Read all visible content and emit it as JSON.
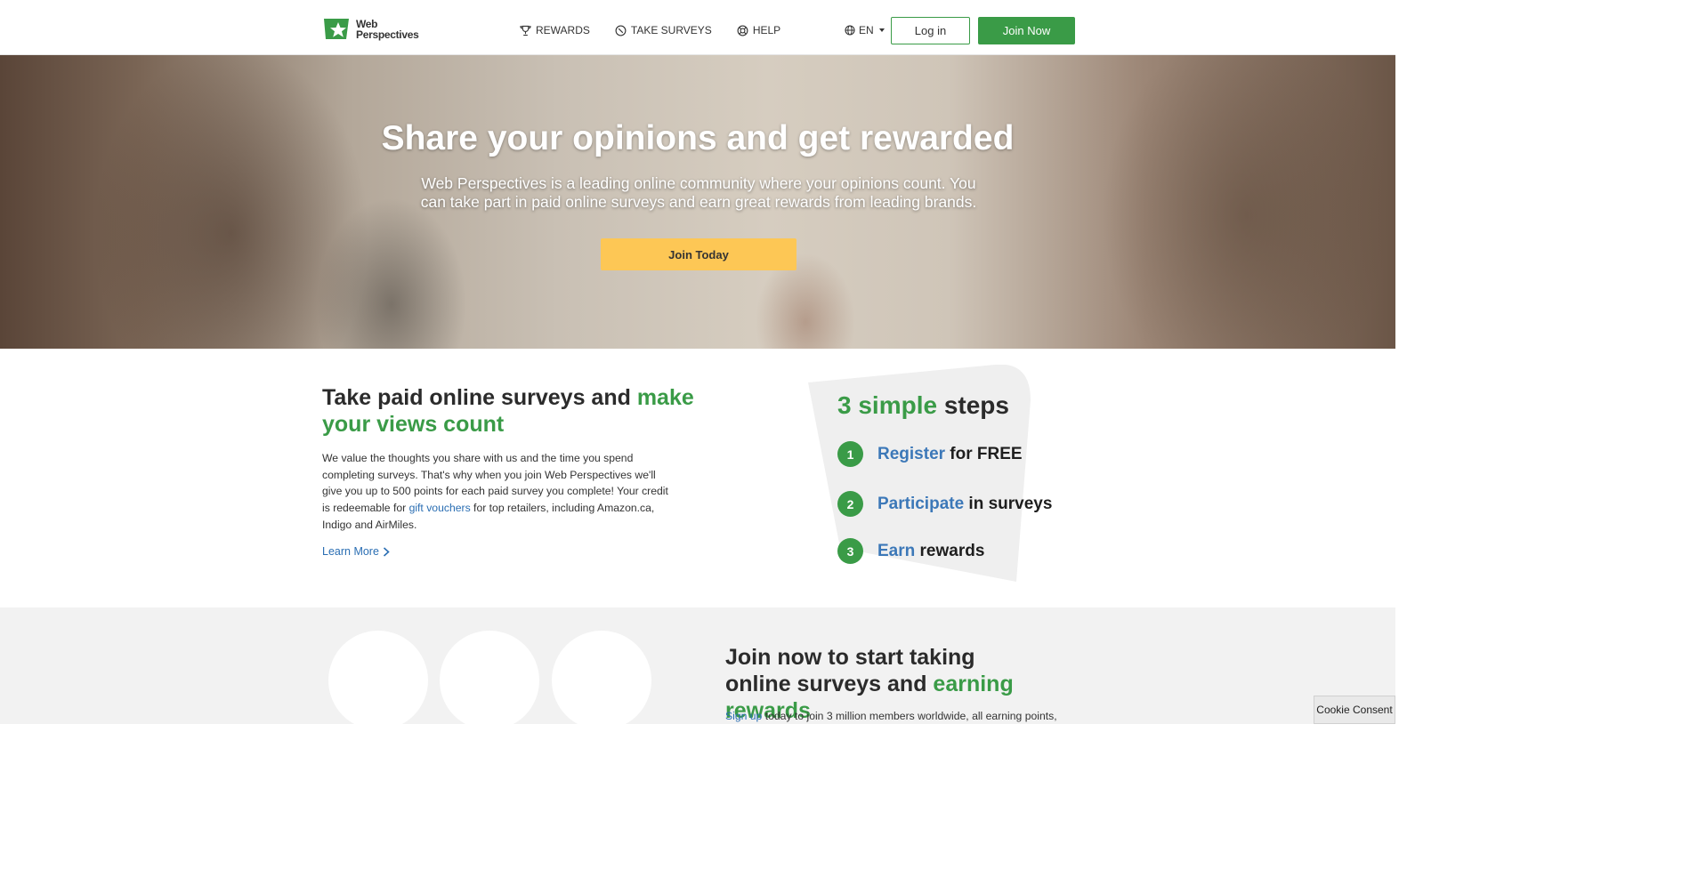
{
  "header": {
    "logo_text_line1": "Web",
    "logo_text_line2": "Perspectives",
    "nav": [
      {
        "label": "REWARDS",
        "icon": "trophy-icon"
      },
      {
        "label": "TAKE SURVEYS",
        "icon": "clock-icon"
      },
      {
        "label": "HELP",
        "icon": "lifebuoy-icon"
      }
    ],
    "language": "EN",
    "login_label": "Log in",
    "join_label": "Join Now"
  },
  "hero": {
    "title": "Share your opinions and get rewarded",
    "subtitle": "Web Perspectives is a leading online community where your opinions count. You can take part in paid online surveys and earn great rewards from leading brands.",
    "cta_label": "Join Today"
  },
  "intro": {
    "title_plain": "Take paid online surveys and ",
    "title_highlight": "make your views count",
    "body_before_link": "We value the thoughts you share with us and the time you spend completing surveys. That's why when you join Web Perspectives we'll give you up to 500 points for each paid survey you complete! Your credit is redeemable for ",
    "body_link": "gift vouchers",
    "body_after_link": " for top retailers, including Amazon.ca, Indigo and AirMiles.",
    "learn_more": "Learn More"
  },
  "steps": {
    "title_highlight": "3 simple",
    "title_plain": " steps",
    "items": [
      {
        "num": "1",
        "highlight": "Register",
        "rest": " for FREE"
      },
      {
        "num": "2",
        "highlight": "Participate",
        "rest": " in surveys"
      },
      {
        "num": "3",
        "highlight": "Earn",
        "rest": " rewards"
      }
    ]
  },
  "join_section": {
    "title_plain": "Join now to start taking online surveys and ",
    "title_highlight": "earning rewards",
    "body_link": "Sign up",
    "body_rest": " today to join 3 million members worldwide, all earning points,"
  },
  "cookie_label": "Cookie Consent",
  "colors": {
    "brand_green": "#3a9b47",
    "cta_yellow": "#fdc755",
    "link_blue": "#2a6eb3"
  }
}
